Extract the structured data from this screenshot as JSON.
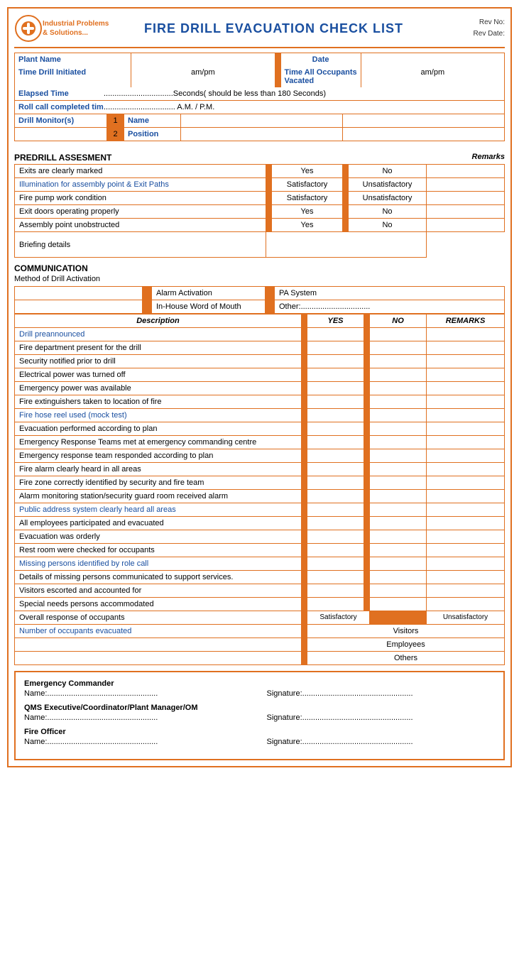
{
  "header": {
    "logo_line1": "Industrial Problems",
    "logo_line2": "& Solutions...",
    "title": "FIRE DRILL EVACUATION CHECK LIST",
    "rev_no": "Rev No:",
    "rev_date": "Rev Date:"
  },
  "info": {
    "plant_name_label": "Plant Name",
    "date_label": "Date",
    "time_drill_label": "Time Drill Initiated",
    "ampm1": "am/pm",
    "time_all_label": "Time All Occupants Vacated",
    "ampm2": "am/pm",
    "elapsed_label": "Elapsed Time",
    "elapsed_value": "................................Seconds( should be less than 180 Seconds)",
    "rollcall_label": "Roll call completed tim",
    "rollcall_value": "................................. A.M. / P.M.",
    "drill_monitors_label": "Drill Monitor(s)",
    "monitor1_num": "1",
    "monitor1_field": "Name",
    "monitor2_num": "2",
    "monitor2_field": "Position"
  },
  "predrill": {
    "title": "PREDRILL ASSESMENT",
    "remarks_header": "Remarks",
    "rows": [
      {
        "label": "Exits are clearly marked",
        "blue": false,
        "col1": "Yes",
        "sep": true,
        "col2": "No",
        "has_rem": true
      },
      {
        "label": "Illumination for assembly point & Exit Paths",
        "blue": true,
        "col1": "Satisfactory",
        "sep": true,
        "col2": "Unsatisfactory",
        "has_rem": true
      },
      {
        "label": "Fire pump work condition",
        "blue": false,
        "col1": "Satisfactory",
        "sep": true,
        "col2": "Unsatisfactory",
        "has_rem": true
      },
      {
        "label": "Exit doors operating properly",
        "blue": false,
        "col1": "Yes",
        "sep": true,
        "col2": "No",
        "has_rem": true
      },
      {
        "label": "Assembly point unobstructed",
        "blue": false,
        "col1": "Yes",
        "sep": true,
        "col2": "No",
        "has_rem": true
      },
      {
        "label": "Briefing details",
        "blue": false,
        "col1": "",
        "sep": false,
        "col2": "",
        "has_rem": false,
        "tall": true
      }
    ]
  },
  "communication": {
    "title": "COMMUNICATION",
    "subtitle": "Method of Drill Activation",
    "method1": "Alarm Activation",
    "method2": "PA System",
    "method3": "In-House Word of Mouth",
    "method4": "Other:................................",
    "table_headers": {
      "description": "Description",
      "yes": "YES",
      "no": "NO",
      "remarks": "REMARKS"
    },
    "rows": [
      {
        "label": "Drill preannounced",
        "blue": true
      },
      {
        "label": "Fire department present for the drill",
        "blue": false
      },
      {
        "label": "Security notified prior to drill",
        "blue": false
      },
      {
        "label": "Electrical power was turned off",
        "blue": false
      },
      {
        "label": "Emergency power was available",
        "blue": false
      },
      {
        "label": "Fire extinguishers taken to location of fire",
        "blue": false
      },
      {
        "label": "Fire hose reel used (mock test)",
        "blue": true
      },
      {
        "label": "Evacuation performed according to plan",
        "blue": false
      },
      {
        "label": "Emergency Response Teams met at emergency commanding centre",
        "blue": false
      },
      {
        "label": "Emergency response team responded according to plan",
        "blue": false
      },
      {
        "label": "Fire alarm clearly heard in all areas",
        "blue": false
      },
      {
        "label": "Fire zone correctly identified by security and fire team",
        "blue": false
      },
      {
        "label": "Alarm monitoring station/security guard room received alarm",
        "blue": false
      },
      {
        "label": "Public address system clearly heard all areas",
        "blue": true
      },
      {
        "label": "All employees participated and evacuated",
        "blue": false
      },
      {
        "label": "Evacuation was orderly",
        "blue": false
      },
      {
        "label": "Rest room were checked for occupants",
        "blue": false
      },
      {
        "label": "Missing persons identified by role call",
        "blue": true
      },
      {
        "label": "Details of missing persons communicated to support services.",
        "blue": false
      },
      {
        "label": "Visitors escorted and accounted for",
        "blue": false
      },
      {
        "label": "Special needs persons accommodated",
        "blue": false
      },
      {
        "label": "Overall response of occupants",
        "blue": false,
        "special": "satisfactory_row"
      },
      {
        "label": "Number of occupants evacuated",
        "blue": true,
        "special": "count_row"
      }
    ]
  },
  "signatures": {
    "roles": [
      {
        "title": "Emergency Commander",
        "name_label": "Name:...................................................",
        "sig_label": "Signature:..................................................."
      },
      {
        "title": "QMS Executive/Coordinator/Plant Manager/OM",
        "name_label": "Name:...................................................",
        "sig_label": "Signature:..................................................."
      },
      {
        "title": "Fire Officer",
        "name_label": "Name:...................................................",
        "sig_label": "Signature:..................................................."
      }
    ]
  }
}
